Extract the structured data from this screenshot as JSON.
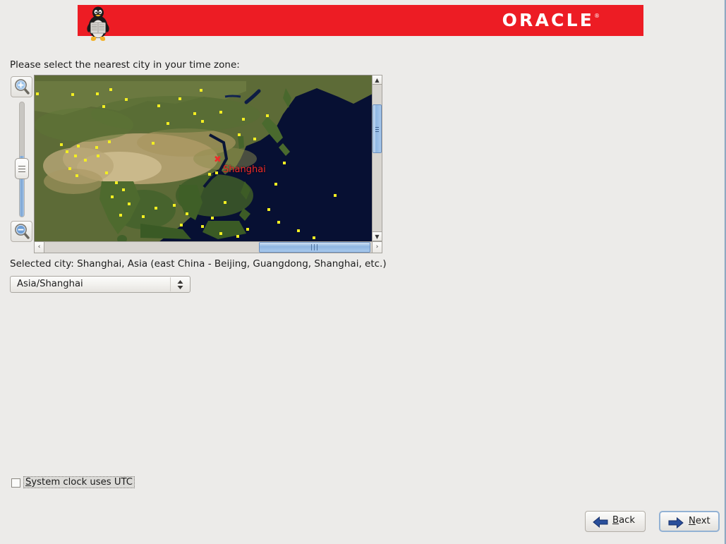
{
  "window": {
    "background_color": "#ecebe9",
    "border_color": "#8fa8c0"
  },
  "banner": {
    "background_color": "#ed1c24",
    "brand": "ORACLE",
    "registered_mark": "®",
    "mascot_icon": "tux-penguin-icon"
  },
  "prompt": {
    "text": "Please select the nearest city in your time zone:"
  },
  "map": {
    "zoom_in_icon": "zoom-in-magnifier-icon",
    "zoom_out_icon": "zoom-out-magnifier-icon",
    "zoom_slider_value": 52,
    "city_marker_glyph": "✖",
    "city_marker_label": "Shanghai",
    "city_label_color": "#ef2b2b",
    "vertical_scroll_up_glyph": "▲",
    "vertical_scroll_down_glyph": "▼",
    "horizontal_scroll_left_glyph": "‹",
    "horizontal_scroll_right_glyph": "›",
    "horizontal_thumb_grip": "|||",
    "ocean_color": "#071033"
  },
  "selection": {
    "selected_city_text": "Selected city: Shanghai, Asia (east China - Beijing, Guangdong, Shanghai, etc.)",
    "timezone_value": "Asia/Shanghai",
    "timezone_options": [
      "Asia/Shanghai"
    ]
  },
  "options": {
    "utc_mnemonic": "S",
    "utc_label_rest": "ystem clock uses UTC",
    "utc_checked": false
  },
  "navigation": {
    "back_mnemonic": "B",
    "back_prefix": "",
    "back_suffix": "ack",
    "back_icon": "arrow-left-icon",
    "next_mnemonic": "N",
    "next_prefix": "",
    "next_suffix": "ext",
    "next_icon": "arrow-right-icon",
    "arrow_color": "#2a4f9b"
  }
}
